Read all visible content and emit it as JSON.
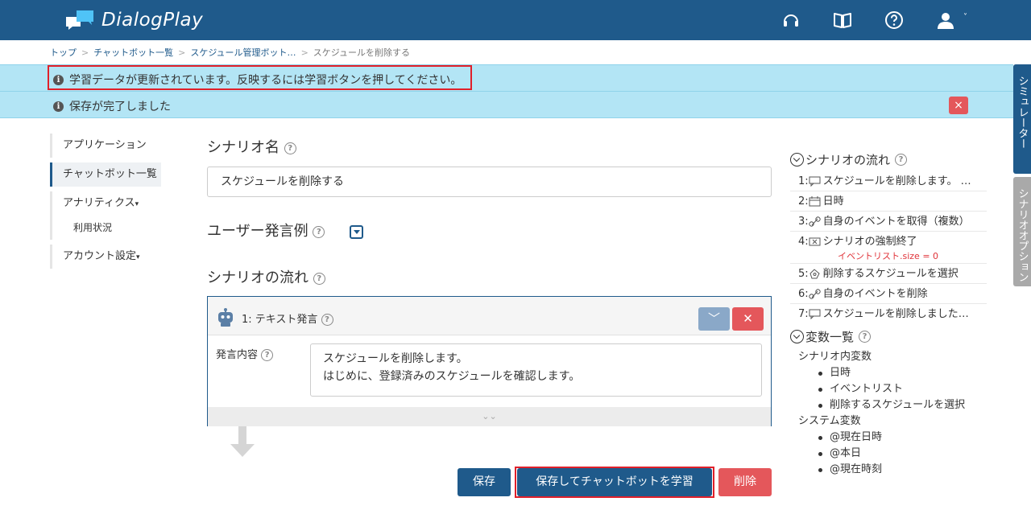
{
  "header": {
    "app_name": "DialogPlay",
    "icons": [
      "headset-icon",
      "book-icon",
      "help-icon",
      "user-icon"
    ],
    "user_caret": "˅"
  },
  "breadcrumb": {
    "items": [
      "トップ",
      "チャットボット一覧",
      "スケジュール管理ボット…",
      "スケジュールを削除する"
    ],
    "separator": ">"
  },
  "alerts": {
    "learn_notice": "学習データが更新されています。反映するには学習ボタンを押してください。",
    "save_notice": "保存が完了しました",
    "close": "×"
  },
  "side_tabs": {
    "simulator": "シミュレーター",
    "scenario_option": "シナリオオプション"
  },
  "nav": {
    "application": "アプリケーション",
    "chatbot_list": "チャットボット一覧",
    "analytics": "アナリティクス",
    "usage": "利用状況",
    "account_settings": "アカウント設定",
    "caret": "▾"
  },
  "form": {
    "scenario_name_title": "シナリオ名",
    "scenario_name_value": "スケジュールを削除する",
    "user_examples_title": "ユーザー発言例",
    "flow_title": "シナリオの流れ",
    "help": "?"
  },
  "flow_card": {
    "title": "1: テキスト発言",
    "label": "発言内容",
    "text": "スケジュールを削除します。\nはじめに、登録済みのスケジュールを確認します。",
    "down": "﹀",
    "delete": "✕",
    "expand": "⌄⌄"
  },
  "buttons": {
    "save": "保存",
    "save_and_learn": "保存してチャットボットを学習",
    "delete": "削除"
  },
  "right_panel": {
    "flow_title": "シナリオの流れ",
    "flow_items": [
      {
        "num": "1:",
        "icon": "speech-bubble-icon",
        "text": "スケジュールを削除します。 …"
      },
      {
        "num": "2:",
        "icon": "calendar-icon",
        "text": "日時"
      },
      {
        "num": "3:",
        "icon": "link-icon",
        "text": "自身のイベントを取得（複数）"
      },
      {
        "num": "4:",
        "icon": "terminate-icon",
        "text": "シナリオの強制終了",
        "sub": "イベントリスト.size = 0"
      },
      {
        "num": "5:",
        "icon": "select-icon",
        "text": "削除するスケジュールを選択"
      },
      {
        "num": "6:",
        "icon": "link-icon",
        "text": "自身のイベントを削除"
      },
      {
        "num": "7:",
        "icon": "speech-bubble-icon",
        "text": "スケジュールを削除しました…"
      }
    ],
    "vars_title": "変数一覧",
    "scenario_vars_title": "シナリオ内変数",
    "scenario_vars": [
      "日時",
      "イベントリスト",
      "削除するスケジュールを選択"
    ],
    "system_vars_title": "システム変数",
    "system_vars": [
      "@現在日時",
      "@本日",
      "@現在時刻"
    ]
  }
}
